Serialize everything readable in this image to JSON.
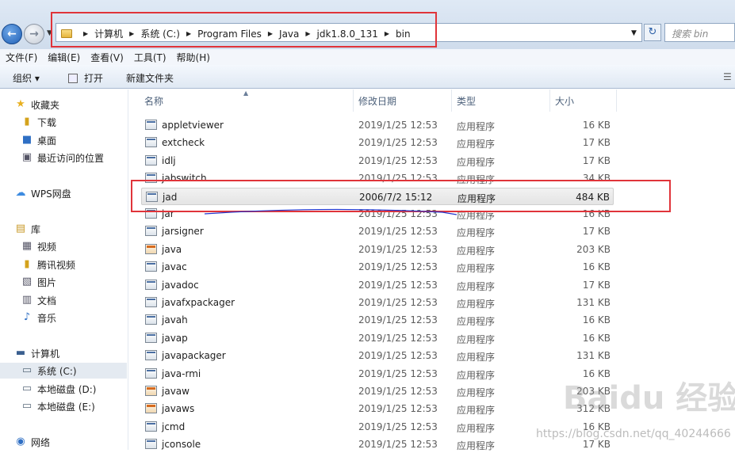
{
  "address": {
    "crumbs": [
      "计算机",
      "系统 (C:)",
      "Program Files",
      "Java",
      "jdk1.8.0_131",
      "bin"
    ],
    "search_placeholder": "搜索 bin"
  },
  "menu": [
    "文件(F)",
    "编辑(E)",
    "查看(V)",
    "工具(T)",
    "帮助(H)"
  ],
  "toolbar": {
    "organize": "组织 ▾",
    "open": "打开",
    "new_folder": "新建文件夹"
  },
  "sidebar": {
    "favorites": "收藏夹",
    "downloads": "下载",
    "desktop": "桌面",
    "recent": "最近访问的位置",
    "wps": "WPS网盘",
    "library": "库",
    "videos": "视频",
    "tencent_video": "腾讯视频",
    "pictures": "图片",
    "documents": "文档",
    "music": "音乐",
    "computer": "计算机",
    "drive_c": "系统 (C:)",
    "drive_d": "本地磁盘 (D:)",
    "drive_e": "本地磁盘 (E:)",
    "network": "网络"
  },
  "columns": {
    "name": "名称",
    "date": "修改日期",
    "type": "类型",
    "size": "大小"
  },
  "files": [
    {
      "name": "appletviewer",
      "date": "2019/1/25 12:53",
      "type": "应用程序",
      "size": "16 KB"
    },
    {
      "name": "extcheck",
      "date": "2019/1/25 12:53",
      "type": "应用程序",
      "size": "17 KB"
    },
    {
      "name": "idlj",
      "date": "2019/1/25 12:53",
      "type": "应用程序",
      "size": "17 KB"
    },
    {
      "name": "jabswitch",
      "date": "2019/1/25 12:53",
      "type": "应用程序",
      "size": "34 KB"
    },
    {
      "name": "jad",
      "date": "2006/7/2 15:12",
      "type": "应用程序",
      "size": "484 KB"
    },
    {
      "name": "jar",
      "date": "2019/1/25 12:53",
      "type": "应用程序",
      "size": "16 KB"
    },
    {
      "name": "jarsigner",
      "date": "2019/1/25 12:53",
      "type": "应用程序",
      "size": "17 KB"
    },
    {
      "name": "java",
      "date": "2019/1/25 12:53",
      "type": "应用程序",
      "size": "203 KB"
    },
    {
      "name": "javac",
      "date": "2019/1/25 12:53",
      "type": "应用程序",
      "size": "16 KB"
    },
    {
      "name": "javadoc",
      "date": "2019/1/25 12:53",
      "type": "应用程序",
      "size": "17 KB"
    },
    {
      "name": "javafxpackager",
      "date": "2019/1/25 12:53",
      "type": "应用程序",
      "size": "131 KB"
    },
    {
      "name": "javah",
      "date": "2019/1/25 12:53",
      "type": "应用程序",
      "size": "16 KB"
    },
    {
      "name": "javap",
      "date": "2019/1/25 12:53",
      "type": "应用程序",
      "size": "16 KB"
    },
    {
      "name": "javapackager",
      "date": "2019/1/25 12:53",
      "type": "应用程序",
      "size": "131 KB"
    },
    {
      "name": "java-rmi",
      "date": "2019/1/25 12:53",
      "type": "应用程序",
      "size": "16 KB"
    },
    {
      "name": "javaw",
      "date": "2019/1/25 12:53",
      "type": "应用程序",
      "size": "203 KB"
    },
    {
      "name": "javaws",
      "date": "2019/1/25 12:53",
      "type": "应用程序",
      "size": "312 KB"
    },
    {
      "name": "jcmd",
      "date": "2019/1/25 12:53",
      "type": "应用程序",
      "size": "16 KB"
    },
    {
      "name": "jconsole",
      "date": "2019/1/25 12:53",
      "type": "应用程序",
      "size": "17 KB"
    }
  ],
  "watermark": "https://blog.csdn.net/qq_40244666",
  "watermark_logo": "Baidu 经验"
}
